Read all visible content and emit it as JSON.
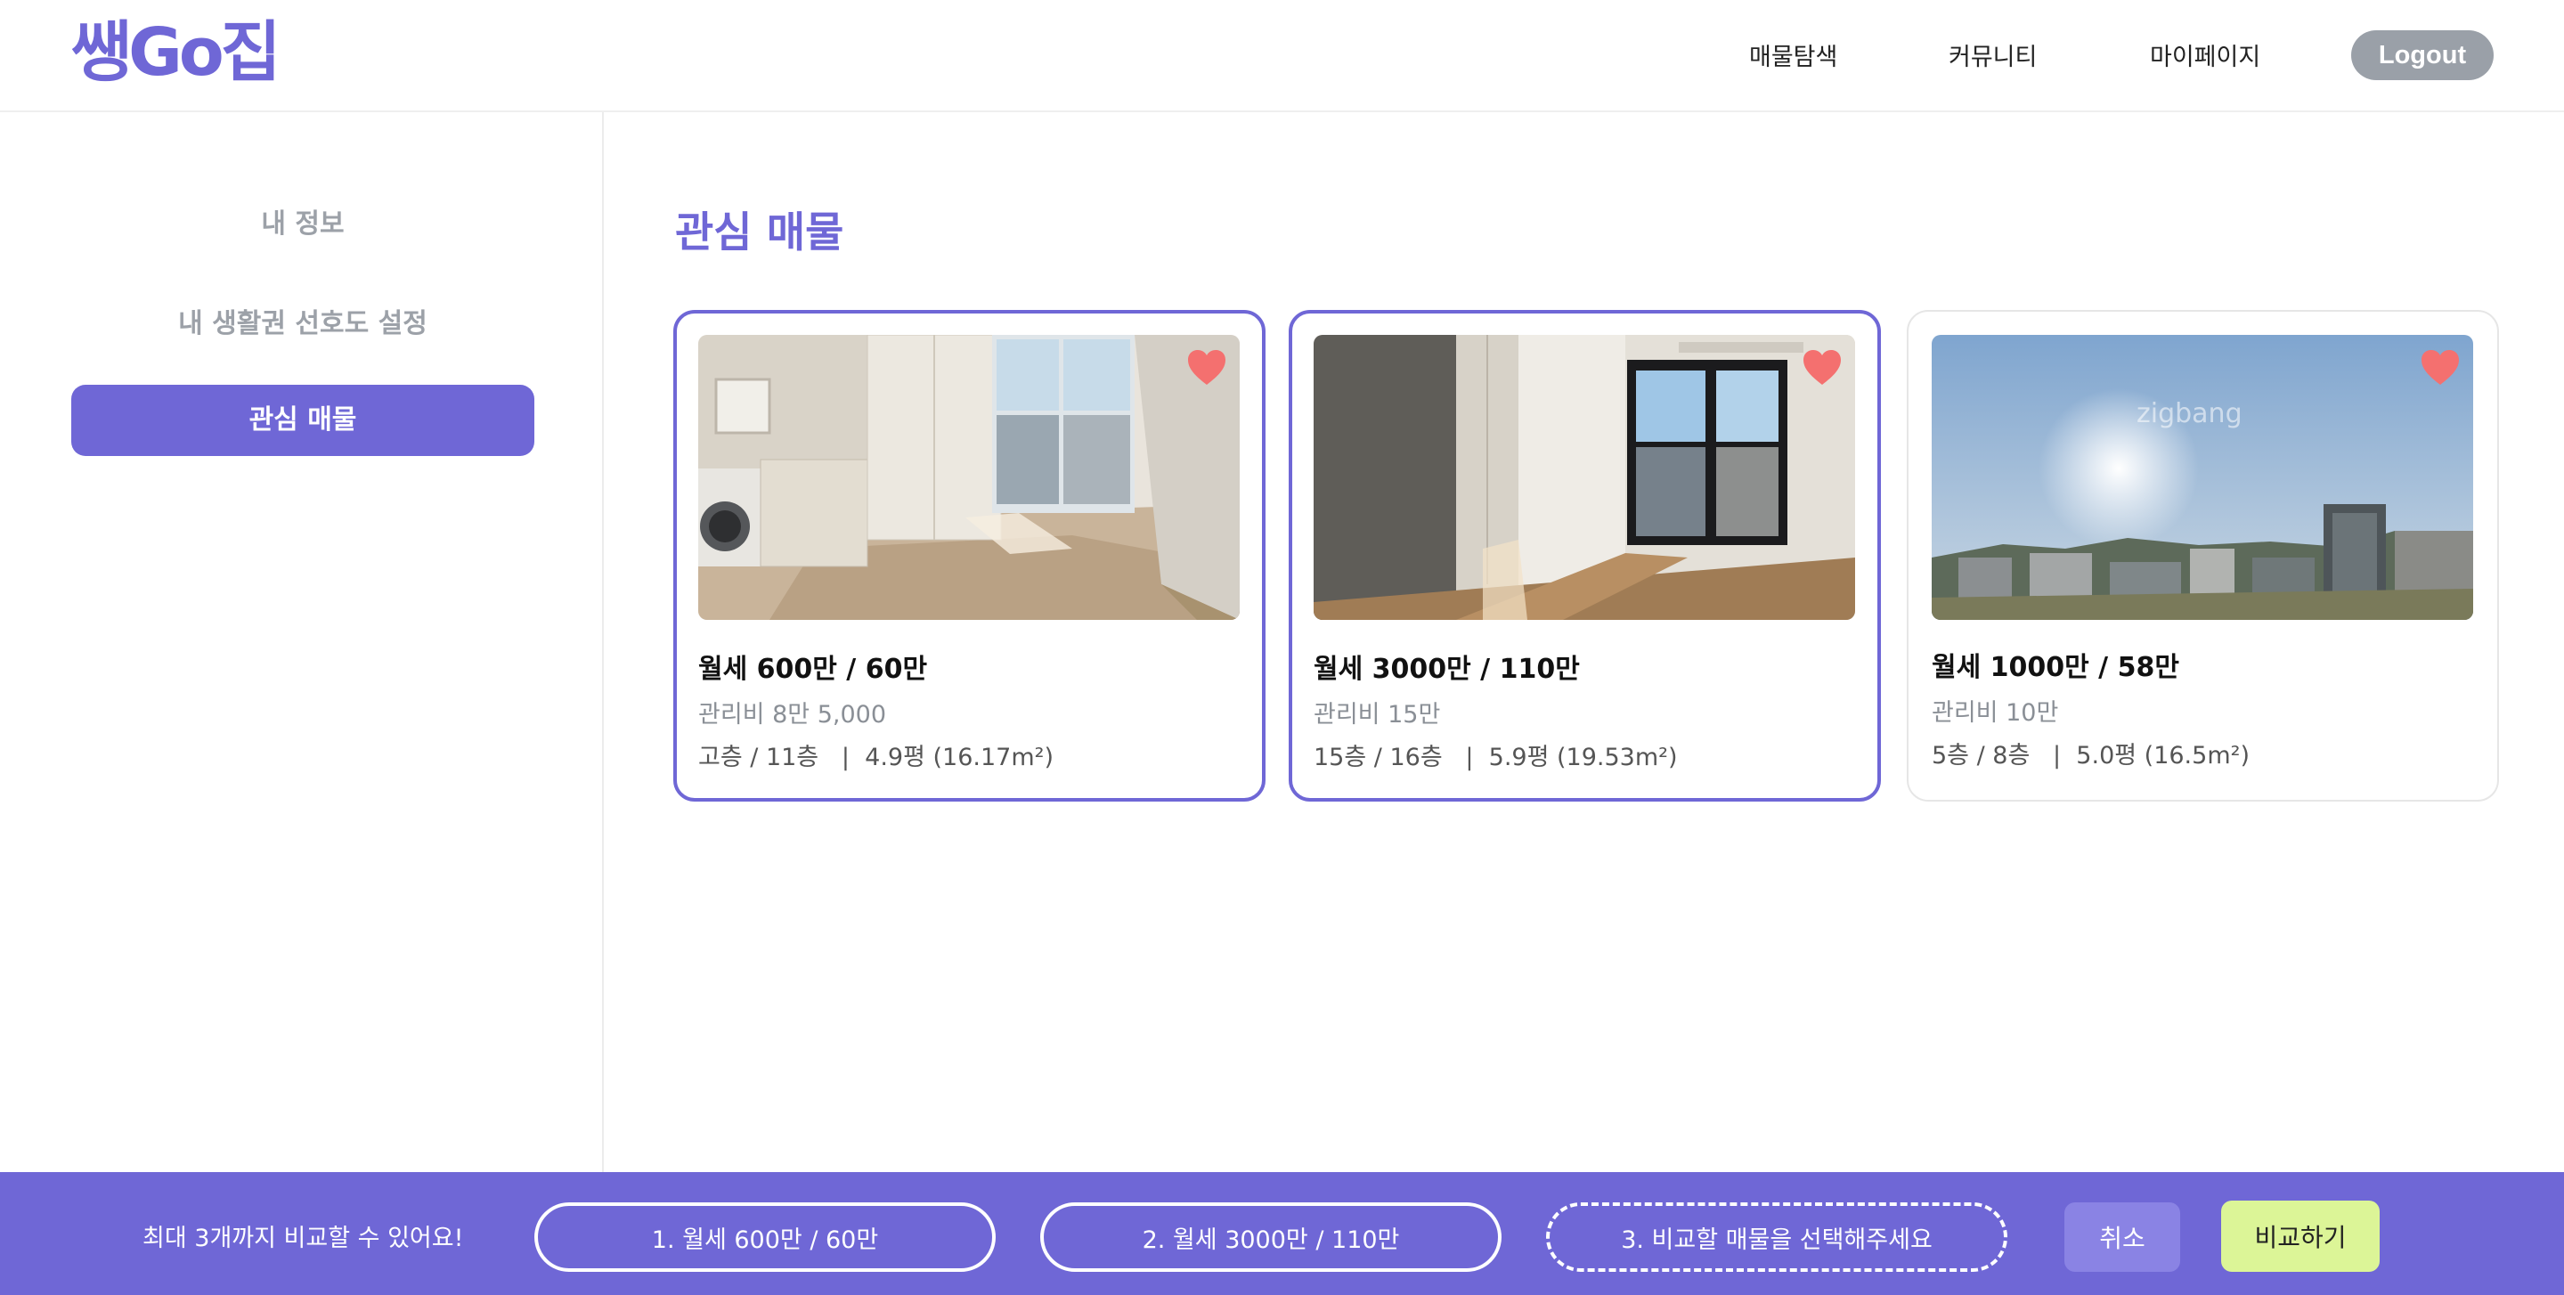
{
  "header": {
    "logo": "쌩Go집",
    "nav": [
      "매물탐색",
      "커뮤니티",
      "마이페이지"
    ],
    "logout": "Logout"
  },
  "sidebar": {
    "items": [
      {
        "label": "내 정보",
        "active": false
      },
      {
        "label": "내 생활권 선호도 설정",
        "active": false
      },
      {
        "label": "관심 매물",
        "active": true
      }
    ]
  },
  "main": {
    "title": "관심 매물",
    "cards": [
      {
        "price": "월세 600만 / 60만",
        "fee": "관리비 8만 5,000",
        "detail": "고층 / 11층   |  4.9평 (16.17m²)",
        "selected": true,
        "liked": true
      },
      {
        "price": "월세 3000만 / 110만",
        "fee": "관리비 15만",
        "detail": "15층 / 16층   |  5.9평 (19.53m²)",
        "selected": true,
        "liked": true
      },
      {
        "price": "월세 1000만 / 58만",
        "fee": "관리비 10만",
        "detail": "5층 / 8층   |  5.0평 (16.5m²)",
        "selected": false,
        "liked": true
      }
    ],
    "watermark": "zigbang"
  },
  "compare_bar": {
    "message": "최대 3개까지 비교할 수 있어요!",
    "slots": [
      "1. 월세 600만 / 60만",
      "2. 월세 3000만 / 110만",
      "3. 비교할 매물을 선택해주세요"
    ],
    "cancel": "취소",
    "compare": "비교하기"
  },
  "colors": {
    "accent": "#6f67d6",
    "heart": "#f4706f",
    "compare_button": "#dcf597",
    "logout_bg": "#9aa0a8"
  }
}
